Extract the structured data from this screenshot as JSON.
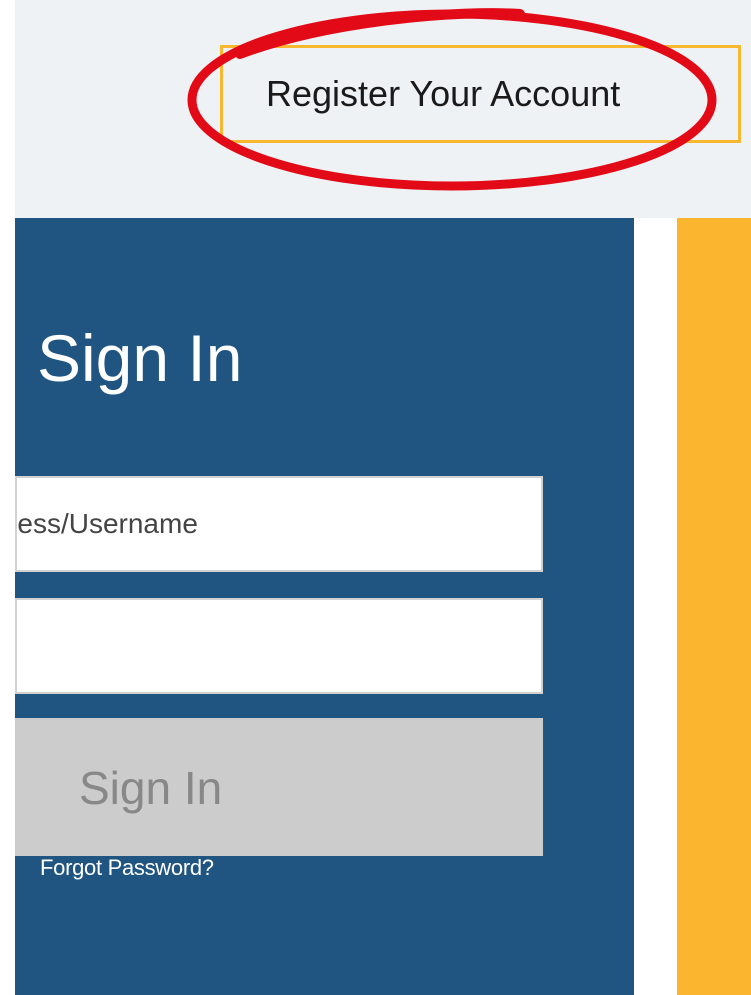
{
  "header": {
    "register_label": "Register Your Account"
  },
  "signin": {
    "title": "Sign In",
    "username_placeholder": "Email Address/Username",
    "password_value": "",
    "button_label": "Sign In",
    "forgot_label": "Forgot Password?"
  },
  "colors": {
    "panel": "#1f5580",
    "accent": "#fbb52e",
    "annotation": "#e30a17",
    "top_bar": "#eff2f5"
  }
}
